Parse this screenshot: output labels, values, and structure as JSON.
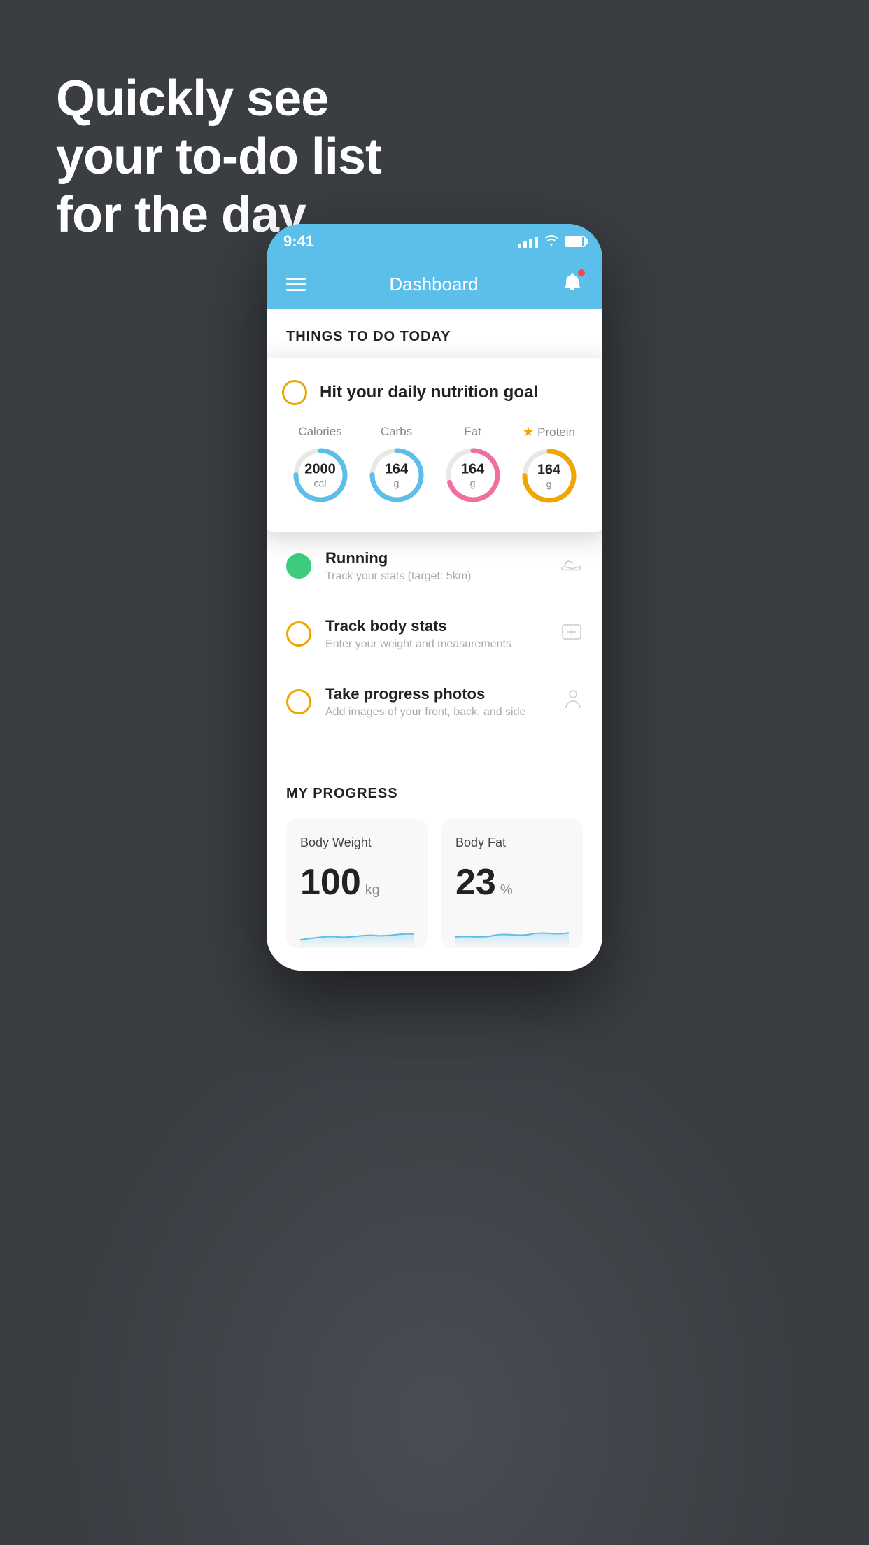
{
  "background": {
    "color": "#3a3d42"
  },
  "headline": {
    "line1": "Quickly see",
    "line2": "your to-do list",
    "line3": "for the day."
  },
  "phone": {
    "status_bar": {
      "time": "9:41"
    },
    "header": {
      "title": "Dashboard"
    },
    "section_title": "THINGS TO DO TODAY",
    "nutrition_card": {
      "title": "Hit your daily nutrition goal",
      "items": [
        {
          "label": "Calories",
          "value": "2000",
          "unit": "cal",
          "ring_type": "blue",
          "starred": false
        },
        {
          "label": "Carbs",
          "value": "164",
          "unit": "g",
          "ring_type": "blue",
          "starred": false
        },
        {
          "label": "Fat",
          "value": "164",
          "unit": "g",
          "ring_type": "pink",
          "starred": false
        },
        {
          "label": "Protein",
          "value": "164",
          "unit": "g",
          "ring_type": "gold",
          "starred": true
        }
      ]
    },
    "todo_items": [
      {
        "title": "Running",
        "subtitle": "Track your stats (target: 5km)",
        "status": "done",
        "icon": "shoe"
      },
      {
        "title": "Track body stats",
        "subtitle": "Enter your weight and measurements",
        "status": "pending",
        "icon": "scale"
      },
      {
        "title": "Take progress photos",
        "subtitle": "Add images of your front, back, and side",
        "status": "pending",
        "icon": "person"
      }
    ],
    "progress_section": {
      "title": "MY PROGRESS",
      "cards": [
        {
          "title": "Body Weight",
          "value": "100",
          "unit": "kg"
        },
        {
          "title": "Body Fat",
          "value": "23",
          "unit": "%"
        }
      ]
    }
  }
}
